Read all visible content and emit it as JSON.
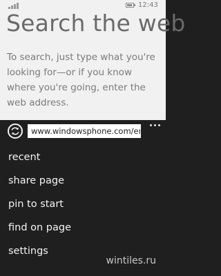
{
  "status_bar": {
    "time": "12:43",
    "icons": [
      "signal-icon",
      "battery-icon"
    ]
  },
  "page": {
    "title": "Search the web",
    "description": "To search, just type what you're looking for—or if you know where you're going, enter the web address."
  },
  "address_bar": {
    "refresh_icon": "refresh-icon",
    "url": "www.windowsphone.com/en",
    "more_icon": "more-dots-icon"
  },
  "menu": {
    "items": [
      {
        "label": "recent"
      },
      {
        "label": "share page"
      },
      {
        "label": "pin to start"
      },
      {
        "label": "find on page"
      },
      {
        "label": "settings"
      }
    ]
  },
  "watermark": "wintiles.ru",
  "colors": {
    "top_background": "#f1f1f1",
    "app_bar_background": "#1f1f1f",
    "text_light": "#f4f4f4"
  }
}
